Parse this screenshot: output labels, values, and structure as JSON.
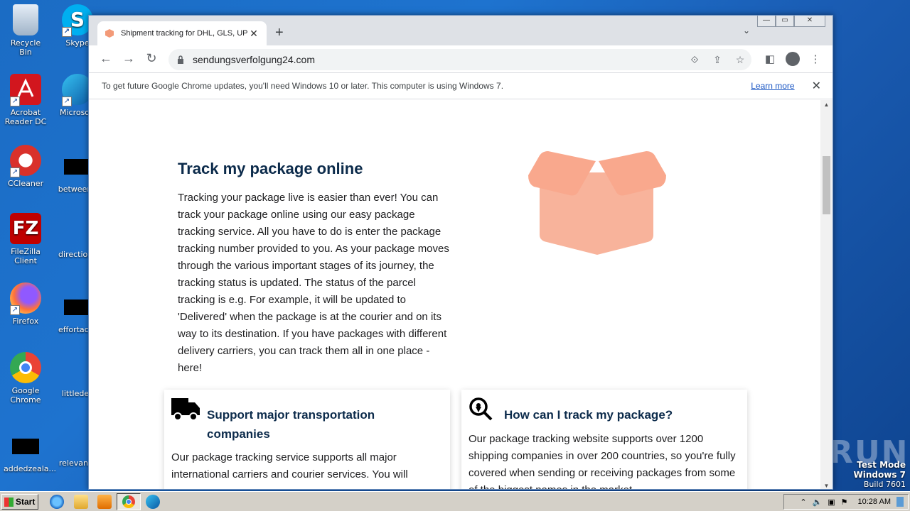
{
  "desktop": {
    "icons": [
      {
        "label": "Recycle Bin"
      },
      {
        "label": "Skype"
      },
      {
        "label": "Acrobat Reader DC"
      },
      {
        "label": "Microsoft"
      },
      {
        "label": "CCleaner"
      },
      {
        "label": "betweeng"
      },
      {
        "label": "FileZilla Client"
      },
      {
        "label": "directions"
      },
      {
        "label": "Firefox"
      },
      {
        "label": "effortacth"
      },
      {
        "label": "Google Chrome"
      },
      {
        "label": "littledec"
      },
      {
        "label": "addedzeala..."
      },
      {
        "label": "relevante"
      }
    ],
    "watermark": {
      "line1": "Test Mode",
      "line2": "Windows 7",
      "line3": "Build 7601"
    },
    "anyrun": "ANY RUN"
  },
  "browser": {
    "tab_title": "Shipment tracking for DHL, GLS, UPS",
    "url": "sendungsverfolgung24.com",
    "infobar_message": "To get future Google Chrome updates, you'll need Windows 10 or later. This computer is using Windows 7.",
    "infobar_link": "Learn more"
  },
  "page": {
    "hero_title": "Track my package online",
    "hero_text": "Tracking your package live is easier than ever! You can track your package online using our easy package tracking service. All you have to do is enter the package tracking number provided to you. As your package moves through the various important stages of its journey, the tracking status is updated. The status of the parcel tracking is e.g. For example, it will be updated to 'Delivered' when the package is at the courier and on its way to its destination. If you have packages with different delivery carriers, you can track them all in one place - here!",
    "cards": [
      {
        "title": "Support major transportation companies",
        "text": "Our package tracking service supports all major international carriers and courier services. You will",
        "icon": "truck-icon"
      },
      {
        "title": "How can I track my package?",
        "text": "Our package tracking website supports over 1200 shipping companies in over 200 countries, so you're fully covered when sending or receiving packages from some of the biggest names in the market.",
        "icon": "search-location-icon"
      }
    ]
  },
  "taskbar": {
    "start_label": "Start",
    "clock": "10:28 AM"
  },
  "colors": {
    "heading": "#0c2b4b",
    "box": "#f8b39b",
    "link": "#1a56c4"
  }
}
